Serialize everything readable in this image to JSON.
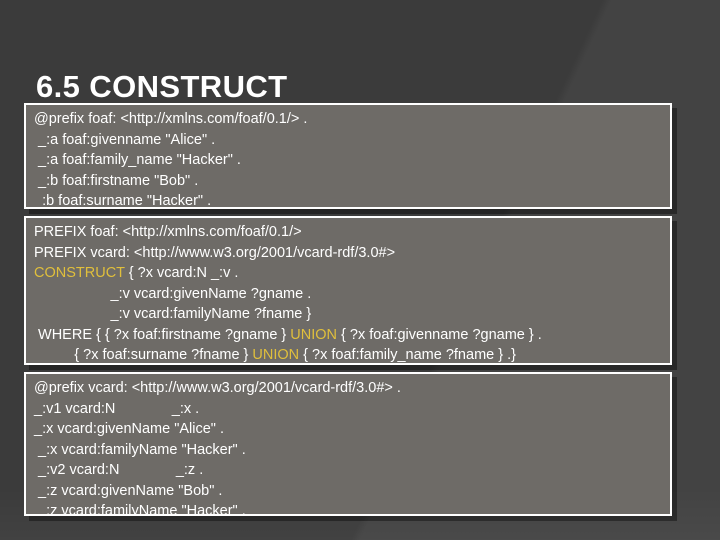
{
  "slide": {
    "title": "6.5 CONSTRUCT",
    "background_color": "#3b3b3b",
    "code_block_color": "#6e6b67",
    "keyword_color": "#e0bf3c",
    "text_color": "#ffffff"
  },
  "blocks": {
    "rdf_input": {
      "name": "input-rdf-data",
      "lines": [
        "@prefix foaf: <http://xmlns.com/foaf/0.1/> .",
        " _:a foaf:givenname \"Alice\" .",
        " _:a foaf:family_name \"Hacker\" .",
        " _:b foaf:firstname \"Bob\" .",
        "_:b foaf:surname \"Hacker\" ."
      ]
    },
    "query": {
      "name": "sparql-construct-query",
      "lines": [
        [
          {
            "t": "PREFIX foaf: <http://xmlns.com/foaf/0.1/>",
            "kw": false
          }
        ],
        [
          {
            "t": "PREFIX vcard: <http://www.w3.org/2001/vcard-rdf/3.0#>",
            "kw": false
          }
        ],
        [
          {
            "t": "CONSTRUCT",
            "kw": true
          },
          {
            "t": " { ?x vcard:N _:v .",
            "kw": false
          }
        ],
        [
          {
            "t": "                   _:v vcard:givenName ?gname .",
            "kw": false
          }
        ],
        [
          {
            "t": "                   _:v vcard:familyName ?fname }",
            "kw": false
          }
        ],
        [
          {
            "t": " WHERE { { ?x foaf:firstname ?gname } ",
            "kw": false
          },
          {
            "t": "UNION",
            "kw": true
          },
          {
            "t": " { ?x foaf:givenname ?gname } .",
            "kw": false
          }
        ],
        [
          {
            "t": "          { ?x foaf:surname ?fname } ",
            "kw": false
          },
          {
            "t": "UNION",
            "kw": true
          },
          {
            "t": " { ?x foaf:family_name ?fname } .}",
            "kw": false
          }
        ]
      ]
    },
    "rdf_output": {
      "name": "output-rdf-data",
      "lines": [
        "@prefix vcard: <http://www.w3.org/2001/vcard-rdf/3.0#> .",
        "_:v1 vcard:N              _:x .",
        "_:x vcard:givenName \"Alice\" .",
        " _:x vcard:familyName \"Hacker\" .",
        " _:v2 vcard:N              _:z .",
        " _:z vcard:givenName \"Bob\" .",
        " _:z vcard:familyName \"Hacker\" ."
      ]
    }
  }
}
